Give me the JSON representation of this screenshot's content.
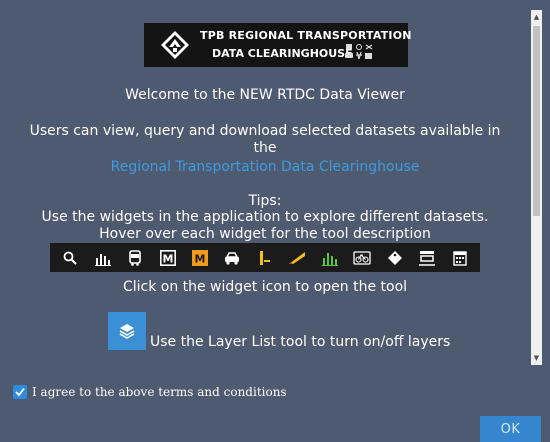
{
  "logo": {
    "line1": "TPB REGIONAL TRANSPORTATION",
    "line2": "DATA CLEARINGHOUSE"
  },
  "content": {
    "welcome": "Welcome to the NEW RTDC Data Viewer",
    "users_line1": "Users can view, query and download selected datasets available in",
    "users_line2": "the",
    "link_text": "Regional Transportation Data Clearinghouse",
    "tips_title": "Tips:",
    "tips_line1": "Use the widgets in the application to explore different datasets.",
    "tips_line2": "Hover over each widget for the tool description",
    "click_hint": "Click on the widget icon to open the tool",
    "layer_hint": "Use the Layer List tool to turn on/off layers"
  },
  "toolbar": {
    "tools": [
      "search-icon",
      "chart-icon",
      "bus-icon",
      "metro-icon",
      "metro-orange-icon",
      "car-icon",
      "signal-icon",
      "ruler-icon",
      "green-chart-icon",
      "bike-icon",
      "tag-icon",
      "rail-icon",
      "calendar-icon"
    ],
    "metro_letter": "M"
  },
  "agreement": {
    "label": "I agree to the above terms and conditions",
    "checked": true
  },
  "buttons": {
    "ok": "OK"
  },
  "colors": {
    "background": "#4d5a6f",
    "link": "#3d9be0",
    "accent": "#3586cf",
    "toolbar": "#1b1b1b"
  }
}
